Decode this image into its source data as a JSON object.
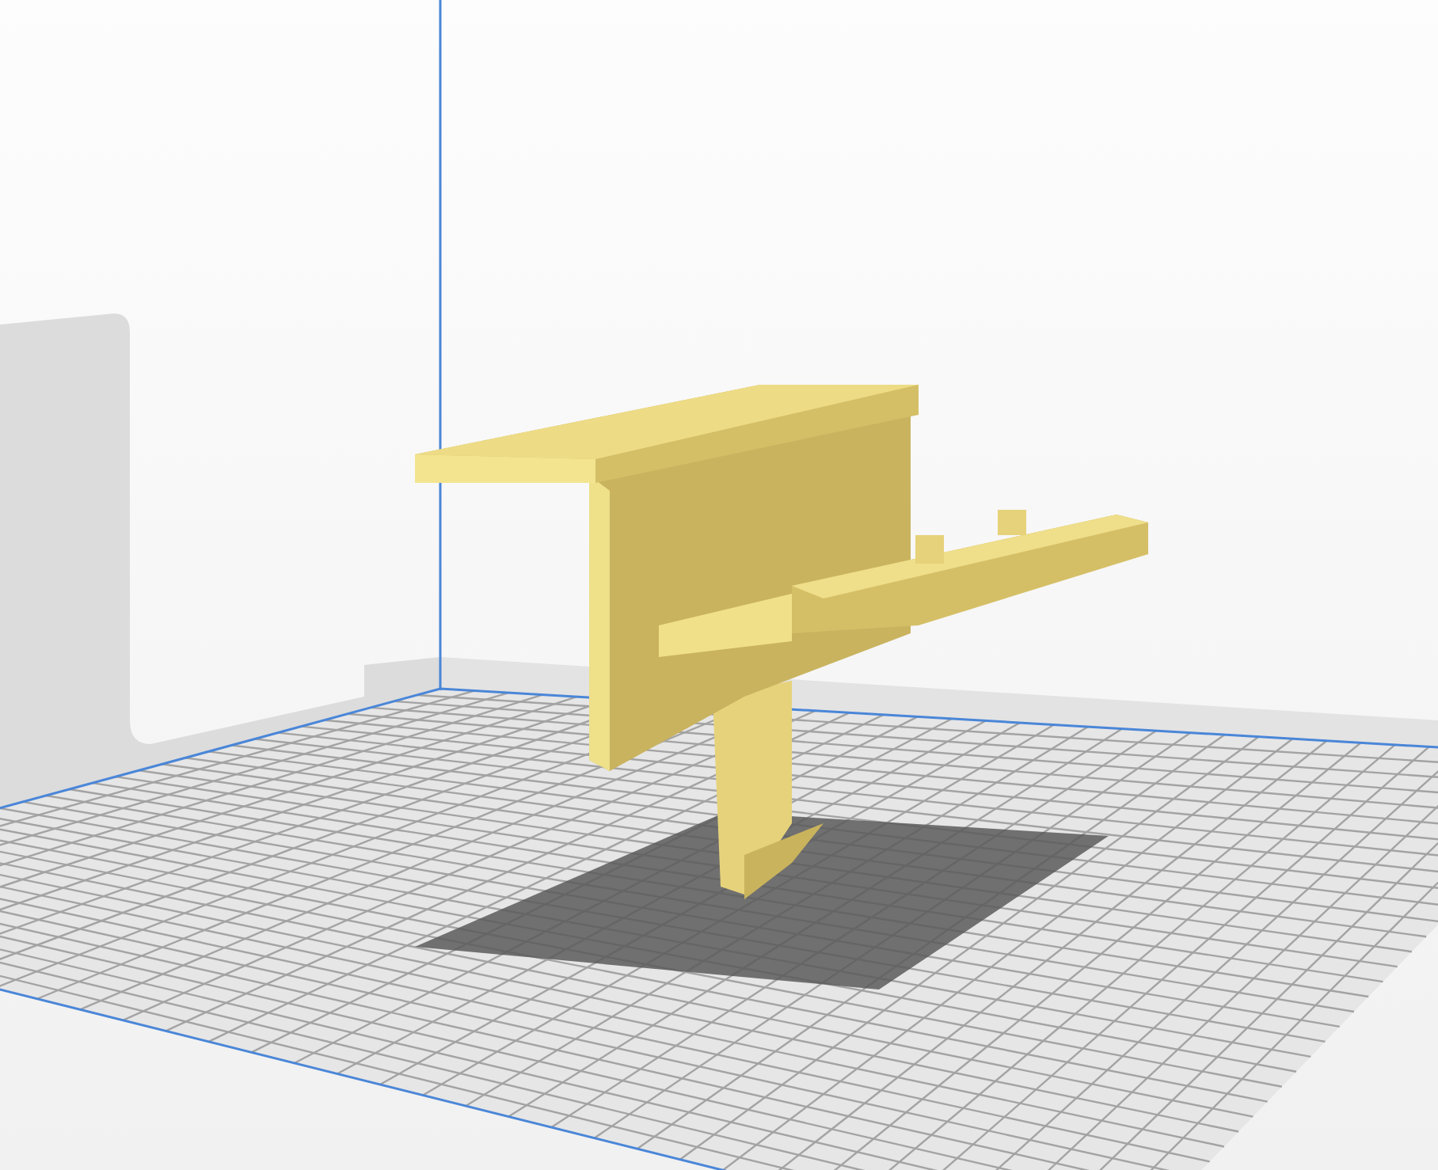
{
  "viewport": {
    "kind": "build-plate-3d"
  }
}
